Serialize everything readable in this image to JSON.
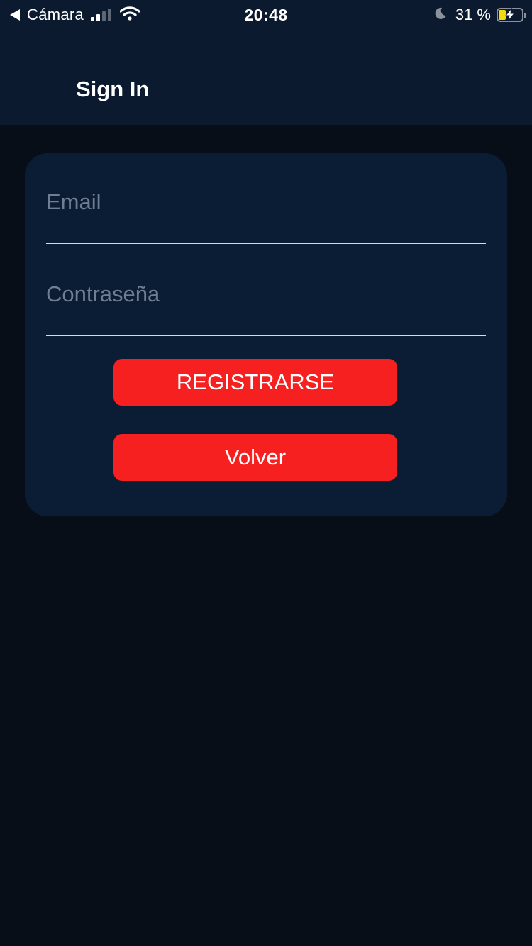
{
  "status_bar": {
    "back_app": "Cámara",
    "time": "20:48",
    "battery_percent": "31 %",
    "battery_level": 0.31,
    "signal_bars": 2,
    "icons": [
      "back-arrow-icon",
      "signal-icon",
      "wifi-icon",
      "moon-icon",
      "battery-charging-icon"
    ]
  },
  "header": {
    "title": "Sign In"
  },
  "form": {
    "email_placeholder": "Email",
    "email_value": "",
    "password_placeholder": "Contraseña",
    "password_value": "",
    "register_label": "REGISTRARSE",
    "back_label": "Volver"
  },
  "colors": {
    "background": "#080e18",
    "header": "#0b1a2e",
    "card": "#0b1d35",
    "button": "#f5201f",
    "placeholder": "#6e7f93"
  }
}
